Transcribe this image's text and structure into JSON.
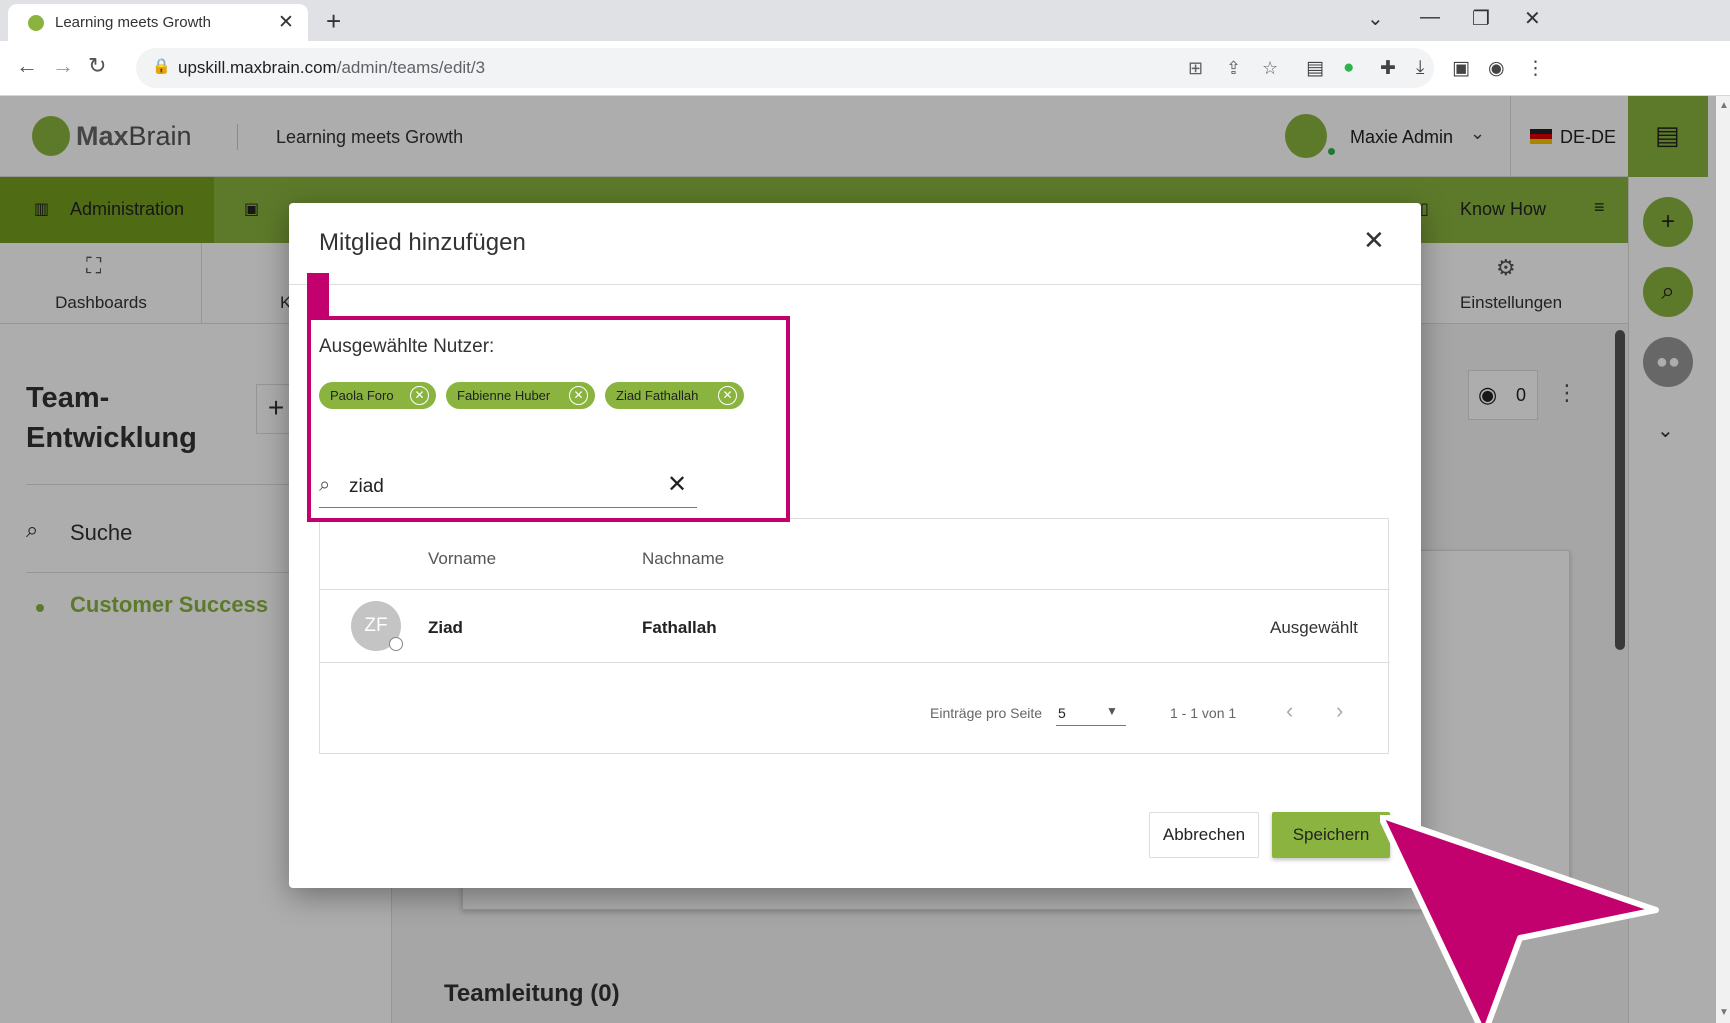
{
  "browser": {
    "tab_title": "Learning meets Growth",
    "url_host": "upskill.maxbrain.com",
    "url_path": "/admin/teams/edit/3"
  },
  "app": {
    "logo_text_bold": "Max",
    "logo_text_rest": "Brain",
    "header_title": "Learning meets Growth",
    "user_name": "Maxie Admin",
    "language": "DE-DE"
  },
  "main_nav": {
    "administration": "Administration",
    "know_how": "Know How"
  },
  "sub_nav": {
    "dashboards": "Dashboards",
    "k_fragment": "K",
    "einstellungen": "Einstellungen"
  },
  "left_panel": {
    "team_title": "Team-Entwicklung",
    "add_symbol": "+",
    "search_label": "Suche",
    "active_item": "Customer Success"
  },
  "content": {
    "views_count": "0",
    "section_title": "Teamleitung (0)"
  },
  "dialog": {
    "title": "Mitglied hinzufügen",
    "selected_label": "Ausgewählte Nutzer:",
    "chips": [
      "Paola Foro",
      "Fabienne Huber",
      "Ziad Fathallah"
    ],
    "search_value": "ziad",
    "table": {
      "headers": {
        "vorname": "Vorname",
        "nachname": "Nachname"
      },
      "rows": [
        {
          "initials": "ZF",
          "vorname": "Ziad",
          "nachname": "Fathallah",
          "status": "Ausgewählt"
        }
      ]
    },
    "pagination": {
      "label": "Einträge pro Seite",
      "page_size": "5",
      "range": "1 - 1 von 1"
    },
    "cancel_label": "Abbrechen",
    "save_label": "Speichern"
  },
  "colors": {
    "accent_green": "#8ab43f",
    "highlight_magenta": "#c2006e"
  }
}
